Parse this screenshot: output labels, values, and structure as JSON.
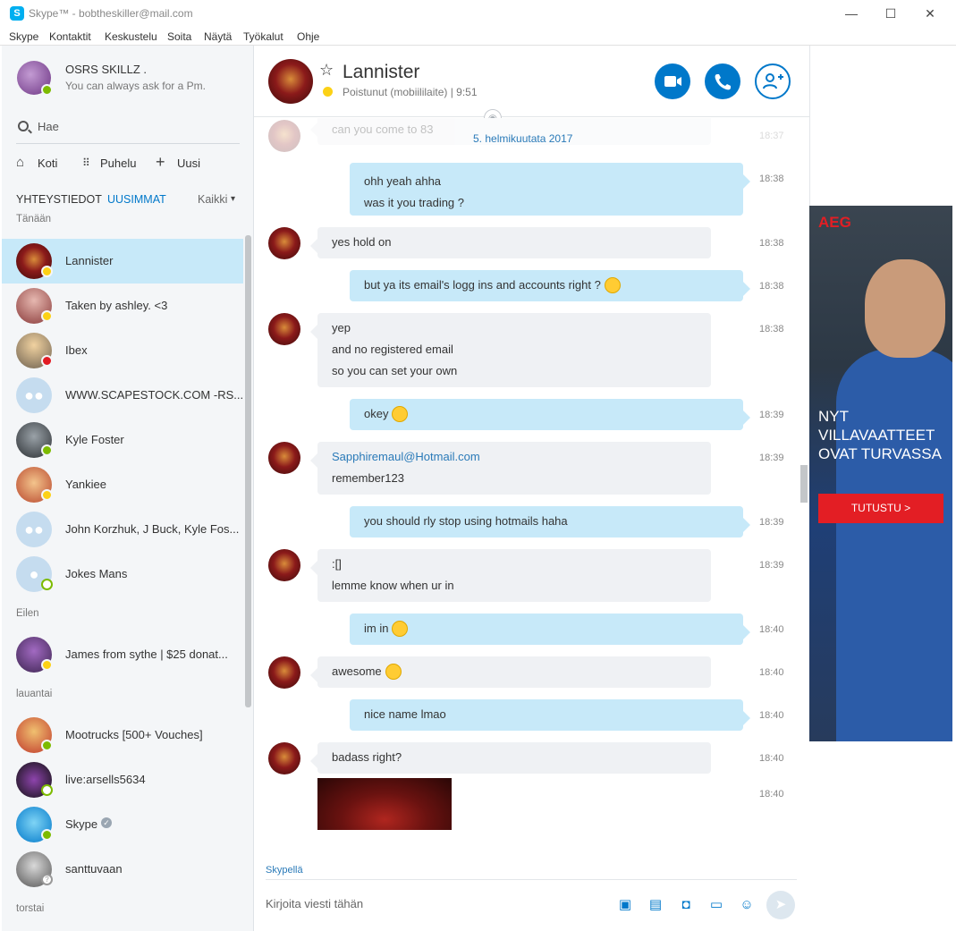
{
  "window": {
    "title": "Skype™ - bobtheskiller@mail.com",
    "app_icon": "S",
    "controls": [
      "—",
      "☐",
      "✕"
    ]
  },
  "menu": [
    "Skype",
    "Kontaktit",
    "Keskustelu",
    "Soita",
    "Näytä",
    "Työkalut",
    "Ohje"
  ],
  "profile": {
    "name": "OSRS SKILLZ .",
    "mood": "You can always ask for a Pm."
  },
  "search": {
    "label": "Hae"
  },
  "nav": {
    "home": "Koti",
    "call": "Puhelu",
    "new": "Uusi"
  },
  "tabs": {
    "contacts": "YHTEYSTIEDOT",
    "recent": "UUSIMMAT",
    "filter": "Kaikki"
  },
  "sections": {
    "today": "Tänään",
    "yesterday": "Eilen",
    "saturday": "lauantai",
    "thursday": "torstai"
  },
  "contacts": [
    {
      "name": "Lannister",
      "status": "away"
    },
    {
      "name": "Taken by ashley. <3",
      "status": "away"
    },
    {
      "name": "Ibex",
      "status": "busy"
    },
    {
      "name": "WWW.SCAPESTOCK.COM -RS...",
      "status": "group"
    },
    {
      "name": "Kyle Foster",
      "status": "online"
    },
    {
      "name": "Yankiee",
      "status": "away"
    },
    {
      "name": "John Korzhuk, J Buck, Kyle Fos...",
      "status": "group"
    },
    {
      "name": "Jokes Mans",
      "status": "offline"
    },
    {
      "name": "James from sythe | $25 donat...",
      "status": "away"
    },
    {
      "name": "Mootrucks [500+ Vouches]",
      "status": "online"
    },
    {
      "name": "live:arsells5634",
      "status": "offline"
    },
    {
      "name": "Skype",
      "status": "online"
    },
    {
      "name": "santtuvaan",
      "status": "unknown"
    }
  ],
  "chat": {
    "name": "Lannister",
    "presence": "Poistunut (mobiililaite)  |  9:51",
    "date_label": "5. helmikuutata 2017",
    "partial_message": "can you come to 83",
    "partial_time": "18:37",
    "messages": [
      {
        "dir": "out",
        "lines": [
          "ohh yeah ahha",
          "was it you trading ?"
        ],
        "time": "18:38"
      },
      {
        "dir": "in",
        "lines": [
          "yes hold on"
        ],
        "time": "18:38"
      },
      {
        "dir": "out",
        "lines": [
          "but ya its email's logg ins and accounts right ?"
        ],
        "time": "18:38",
        "emoji": true
      },
      {
        "dir": "in",
        "lines": [
          "yep",
          "and no registered email",
          "so you can set your own"
        ],
        "time": "18:38"
      },
      {
        "dir": "out",
        "lines": [
          "okey"
        ],
        "time": "18:39",
        "emoji": true
      },
      {
        "dir": "in",
        "lines": [
          "Sapphiremaul@Hotmail.com",
          "remember123"
        ],
        "time": "18:39"
      },
      {
        "dir": "out",
        "lines": [
          "you should rly stop using hotmails haha"
        ],
        "time": "18:39"
      },
      {
        "dir": "in",
        "lines": [
          ":[]",
          "lemme know when ur in"
        ],
        "time": "18:39"
      },
      {
        "dir": "out",
        "lines": [
          "im in"
        ],
        "time": "18:40",
        "emoji": true
      },
      {
        "dir": "in",
        "lines": [
          "awesome"
        ],
        "time": "18:40",
        "emoji": true
      },
      {
        "dir": "out",
        "lines": [
          "nice name lmao"
        ],
        "time": "18:40"
      },
      {
        "dir": "in",
        "lines": [
          "badass right?"
        ],
        "time": "18:40"
      }
    ],
    "image_time": "18:40"
  },
  "composer": {
    "via": "Skypellä",
    "placeholder": "Kirjoita viesti tähän"
  },
  "ad": {
    "brand": "AEG",
    "headline": [
      "NYT",
      "VILLAVAATTEET",
      "OVAT TURVASSA"
    ],
    "cta": "TUTUSTU >"
  },
  "colors": {
    "accent": "#0078ca",
    "outgoing": "#c7e9f9",
    "incoming": "#eff1f4",
    "ad_red": "#e31e24"
  }
}
